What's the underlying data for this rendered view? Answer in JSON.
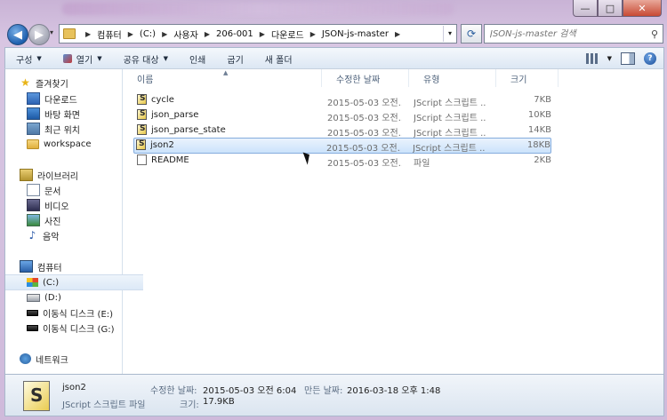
{
  "window": {
    "caption": {
      "minimize": "—",
      "maximize": "□",
      "close": "✕"
    }
  },
  "address": {
    "crumbs": [
      "컴퓨터",
      "(C:)",
      "사용자",
      "206-001",
      "다운로드",
      "JSON-js-master"
    ],
    "search_placeholder": "JSON-js-master 검색"
  },
  "toolbar": {
    "organize": "구성",
    "open": "열기",
    "share": "공유 대상",
    "print": "인쇄",
    "burn": "굽기",
    "new_folder": "새 폴더"
  },
  "sidebar": {
    "favorites": "즐겨찾기",
    "downloads": "다운로드",
    "desktop": "바탕 화면",
    "recent": "최근 위치",
    "workspace": "workspace",
    "libraries": "라이브러리",
    "documents": "문서",
    "videos": "비디오",
    "pictures": "사진",
    "music": "음악",
    "computer": "컴퓨터",
    "drive_c": "(C:)",
    "drive_d": "(D:)",
    "drive_e": "이동식 디스크 (E:)",
    "drive_g": "이동식 디스크 (G:)",
    "network": "네트워크"
  },
  "columns": {
    "name": "이름",
    "date": "수정한 날짜",
    "type": "유형",
    "size": "크기"
  },
  "files": [
    {
      "name": "cycle",
      "date": "2015-05-03 오전...",
      "type": "JScript 스크립트 ...",
      "size": "7KB"
    },
    {
      "name": "json_parse",
      "date": "2015-05-03 오전...",
      "type": "JScript 스크립트 ...",
      "size": "10KB"
    },
    {
      "name": "json_parse_state",
      "date": "2015-05-03 오전...",
      "type": "JScript 스크립트 ...",
      "size": "14KB"
    },
    {
      "name": "json2",
      "date": "2015-05-03 오전...",
      "type": "JScript 스크립트 ...",
      "size": "18KB"
    },
    {
      "name": "README",
      "date": "2015-05-03 오전...",
      "type": "파일",
      "size": "2KB"
    }
  ],
  "details": {
    "name": "json2",
    "type": "JScript 스크립트 파일",
    "modified_label": "수정한 날짜:",
    "modified_value": "2015-05-03 오전 6:04",
    "created_label": "만든 날짜:",
    "created_value": "2016-03-18 오후 1:48",
    "size_label": "크기:",
    "size_value": "17.9KB"
  }
}
